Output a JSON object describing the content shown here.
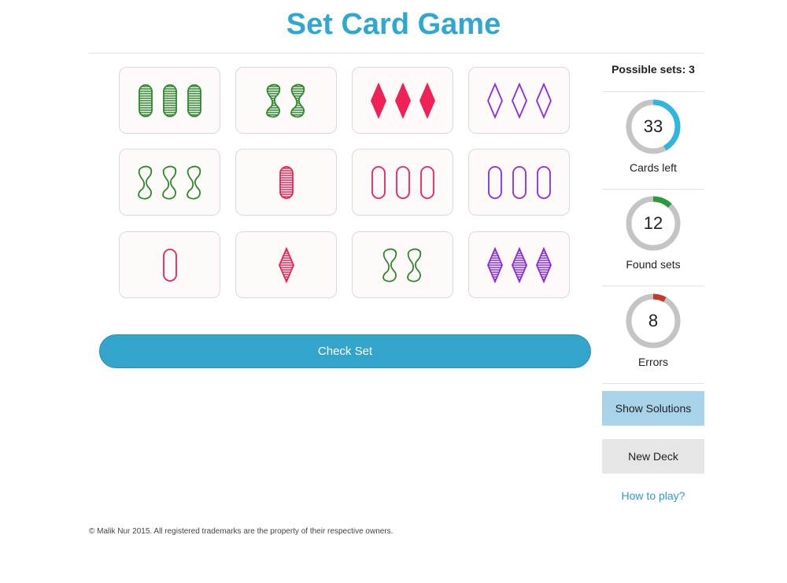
{
  "header": {
    "title": "Set Card Game"
  },
  "colors": {
    "title": "#2ea8d2",
    "green": "#2a8a2a",
    "red": "#ee2255",
    "purple": "#8a2be2",
    "ring_track": "#c4c4c4",
    "cards_left_ring": "#2fb6e0",
    "found_ring": "#2a9a3a",
    "errors_ring": "#c43a2a"
  },
  "board": {
    "cards": [
      {
        "shape": "oval",
        "color": "green",
        "fill": "striped",
        "count": 3
      },
      {
        "shape": "squiggle",
        "color": "green",
        "fill": "striped",
        "count": 2
      },
      {
        "shape": "diamond",
        "color": "red",
        "fill": "solid",
        "count": 3
      },
      {
        "shape": "diamond",
        "color": "purple",
        "fill": "empty",
        "count": 3
      },
      {
        "shape": "squiggle",
        "color": "green",
        "fill": "empty",
        "count": 3
      },
      {
        "shape": "oval",
        "color": "red",
        "fill": "striped",
        "count": 1
      },
      {
        "shape": "oval",
        "color": "red",
        "fill": "empty",
        "count": 3
      },
      {
        "shape": "oval",
        "color": "purple",
        "fill": "empty",
        "count": 3
      },
      {
        "shape": "oval",
        "color": "red",
        "fill": "empty",
        "count": 1
      },
      {
        "shape": "diamond",
        "color": "red",
        "fill": "striped",
        "count": 1
      },
      {
        "shape": "squiggle",
        "color": "green",
        "fill": "empty",
        "count": 2
      },
      {
        "shape": "diamond",
        "color": "purple",
        "fill": "striped",
        "count": 3
      }
    ]
  },
  "actions": {
    "check_set": "Check Set"
  },
  "sidebar": {
    "possible_sets": "Possible sets: 3",
    "cards_left": {
      "value": "33",
      "label": "Cards left",
      "progress": 0.42
    },
    "found_sets": {
      "value": "12",
      "label": "Found sets",
      "progress": 0.12
    },
    "errors": {
      "value": "8",
      "label": "Errors",
      "progress": 0.08
    },
    "show_solutions": "Show Solutions",
    "new_deck": "New Deck",
    "how_to_play": "How to play?"
  },
  "footer": {
    "text": "© Malik Nur 2015. All registered trademarks are the property of their respective owners."
  }
}
